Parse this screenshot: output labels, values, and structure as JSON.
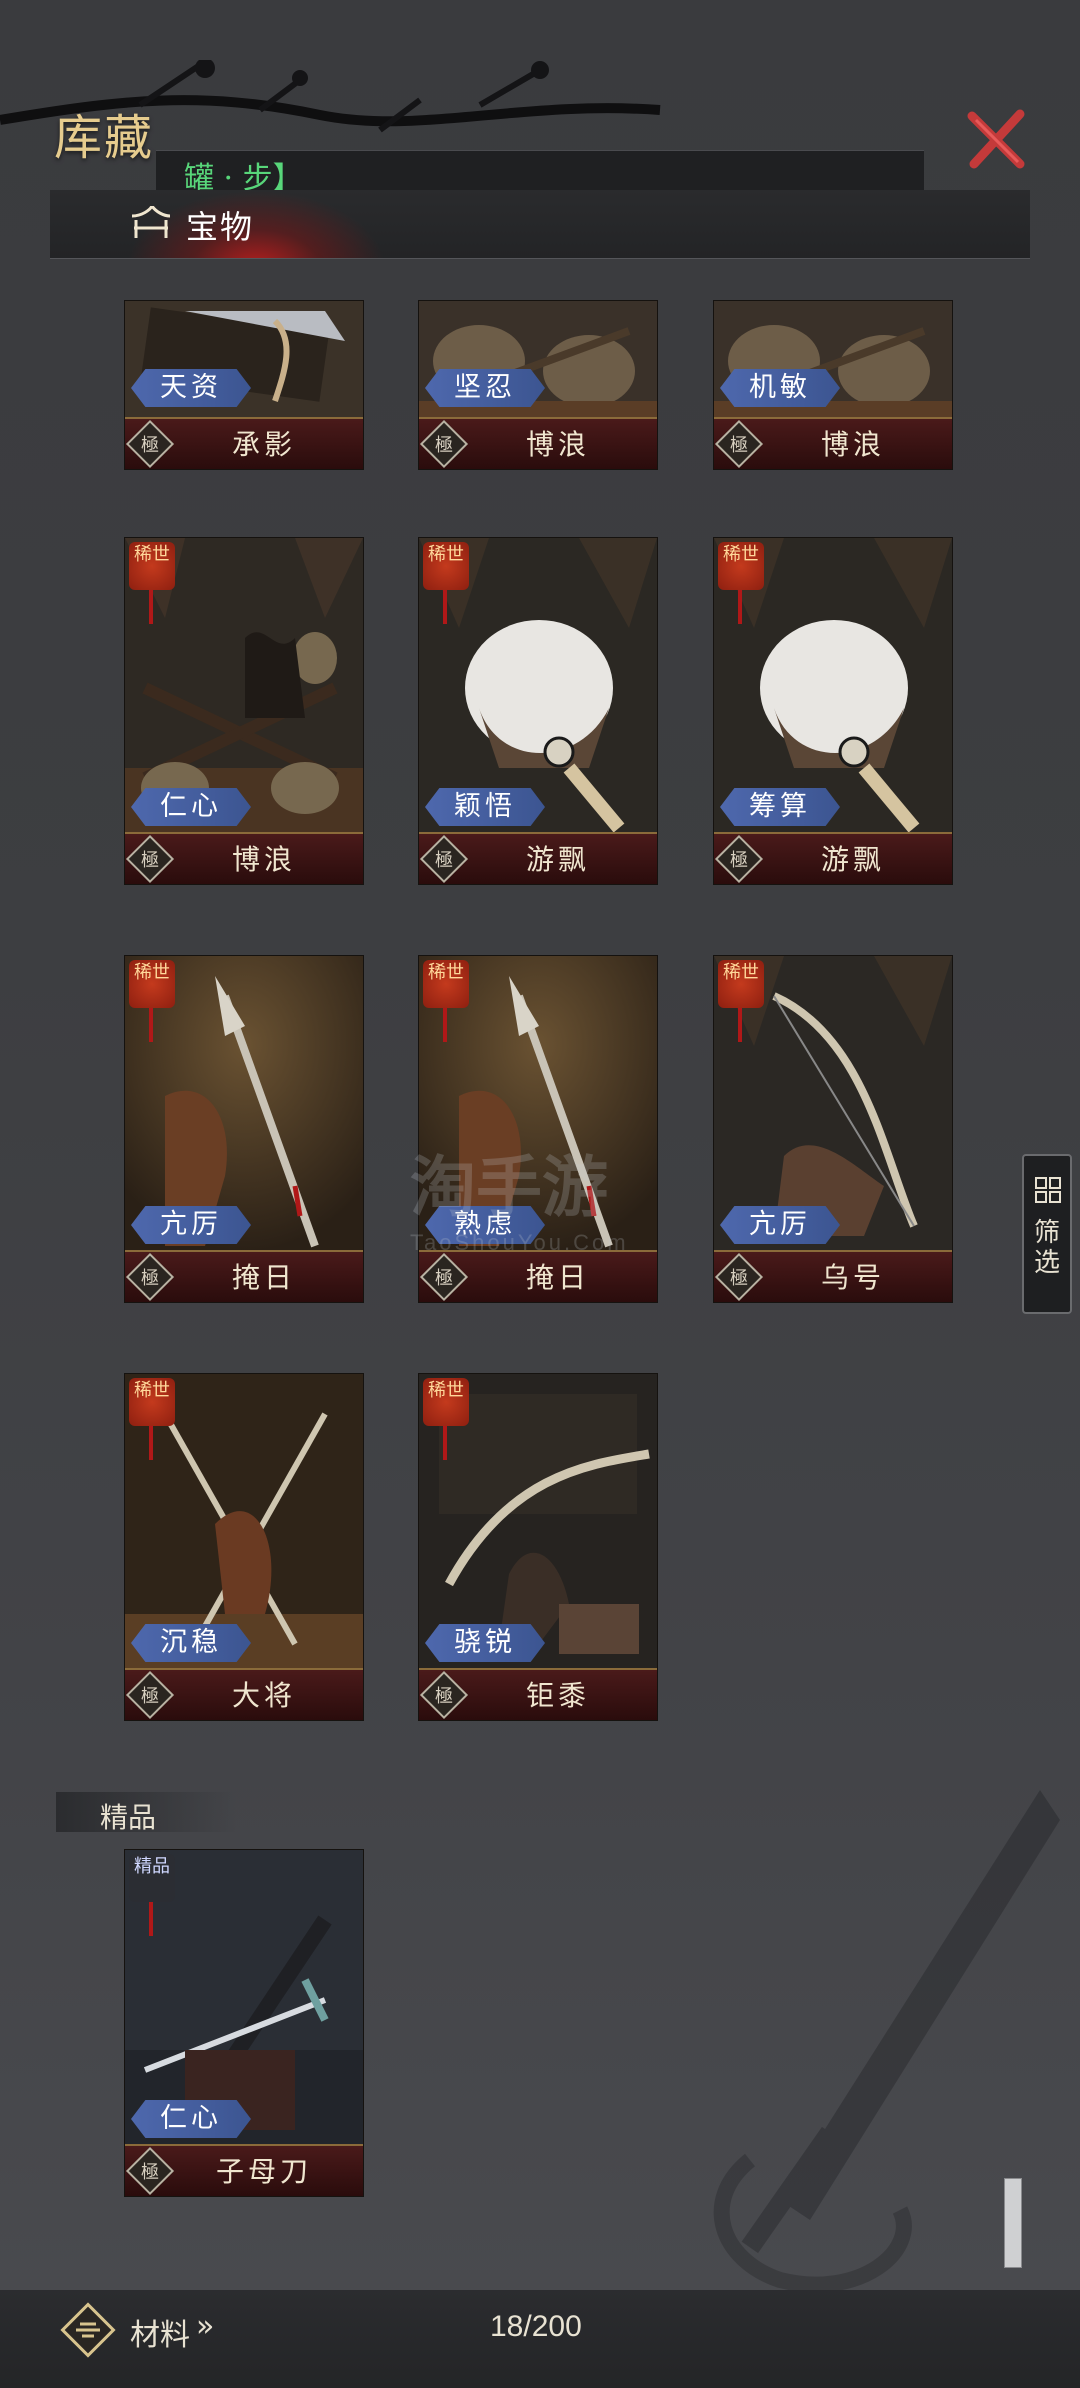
{
  "header": {
    "title": "库藏",
    "subtitle": "罐 · 步】",
    "close_icon": "close-x-icon"
  },
  "tabs": [
    {
      "label": "宝物",
      "icon": "pavilion-icon",
      "active": true
    }
  ],
  "filter": {
    "label": "筛选",
    "icon": "grid-filter-icon"
  },
  "cards": [
    {
      "trait": "天资",
      "grade": "極",
      "name": "承影",
      "rarity": "",
      "art": "sword"
    },
    {
      "trait": "坚忍",
      "grade": "極",
      "name": "博浪",
      "rarity": "",
      "art": "hammer"
    },
    {
      "trait": "机敏",
      "grade": "極",
      "name": "博浪",
      "rarity": "",
      "art": "hammer"
    },
    {
      "trait": "仁心",
      "grade": "極",
      "name": "博浪",
      "rarity": "稀世",
      "art": "hammer"
    },
    {
      "trait": "颖悟",
      "grade": "極",
      "name": "游飘",
      "rarity": "稀世",
      "art": "fan"
    },
    {
      "trait": "筹算",
      "grade": "極",
      "name": "游飘",
      "rarity": "稀世",
      "art": "fan"
    },
    {
      "trait": "亢厉",
      "grade": "極",
      "name": "掩日",
      "rarity": "稀世",
      "art": "halberd"
    },
    {
      "trait": "熟虑",
      "grade": "極",
      "name": "掩日",
      "rarity": "稀世",
      "art": "halberd"
    },
    {
      "trait": "亢厉",
      "grade": "極",
      "name": "乌号",
      "rarity": "稀世",
      "art": "bow"
    },
    {
      "trait": "沉稳",
      "grade": "極",
      "name": "大将",
      "rarity": "稀世",
      "art": "spears"
    },
    {
      "trait": "骁锐",
      "grade": "極",
      "name": "钜黍",
      "rarity": "稀世",
      "art": "bow"
    }
  ],
  "section_jingpin": {
    "label": "精品",
    "cards": [
      {
        "trait": "仁心",
        "grade": "極",
        "name": "子母刀",
        "rarity": "精品",
        "art": "blade"
      }
    ]
  },
  "footer": {
    "materials_label": "材料",
    "materials_arrow": "»",
    "count": "18/200"
  },
  "watermark": {
    "main": "淘手游",
    "sub": "TaoShouYou.Com"
  },
  "colors": {
    "trait_badge": "#4e68ad",
    "bottom_strip": "#3a1212",
    "accent_red": "#c43a3a",
    "title_gold": "#e6cc8e"
  }
}
